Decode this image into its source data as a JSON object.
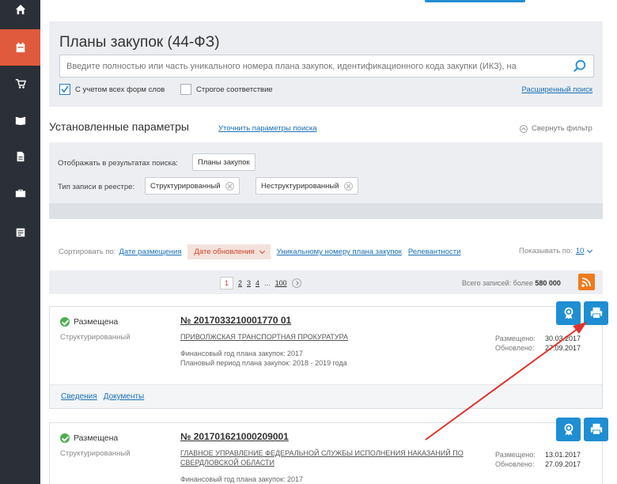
{
  "search": {
    "title": "Планы закупок (44-ФЗ)",
    "placeholder": "Введите полностью или часть уникального номера плана закупок, идентификационного кода закупки (ИКЗ), на",
    "all_forms_label": "С учетом всех форм слов",
    "all_forms_checked": true,
    "strict_label": "Строгое соответствие",
    "strict_checked": false,
    "advanced_link": "Расширенный поиск"
  },
  "params": {
    "heading": "Установленные параметры",
    "refine_link": "Уточнить параметры поиска",
    "collapse_label": "Свернуть фильтр"
  },
  "filters": {
    "show_label": "Отображать в результатах поиска:",
    "show_chip": "Планы закупок",
    "record_type_label": "Тип записи в реестре:",
    "record_chips": [
      "Структурированный",
      "Неструктурированный"
    ]
  },
  "sort": {
    "label": "Сортировать по:",
    "options": [
      "Дате размещения",
      "Дате обновления",
      "Уникальному номеру плана закупок",
      "Релевантности"
    ],
    "active": "Дате обновления",
    "per_page_label": "Показывать по:",
    "per_page_value": "10"
  },
  "pager": {
    "current": "1",
    "pages": [
      "2",
      "3",
      "4"
    ],
    "ellipsis": "...",
    "last": "100",
    "total_label": "Всего записей: более",
    "total_value": "580 000"
  },
  "cards": [
    {
      "status": "Размещена",
      "type": "Структурированный",
      "number": "№ 2017033210001770 01",
      "org": "ПРИВОЛЖСКАЯ ТРАНСПОРТНАЯ ПРОКУРАТУРА",
      "fin_year": "Финансовый год плана закупок: 2017",
      "plan_period": "Плановый период плана закупок: 2018 - 2019 года",
      "placed_label": "Размещено:",
      "placed_value": "30.03.2017",
      "updated_label": "Обновлено:",
      "updated_value": "27.09.2017",
      "links": [
        "Сведения",
        "Документы"
      ]
    },
    {
      "status": "Размещена",
      "type": "Структурированный",
      "number": "№ 201701621000209001",
      "org": "ГЛАВНОЕ УПРАВЛЕНИЕ ФЕДЕРАЛЬНОЙ СЛУЖБЫ ИСПОЛНЕНИЯ НАКАЗАНИЙ ПО СВЕРДЛОВСКОЙ ОБЛАСТИ",
      "fin_year": "Финансовый год плана закупок: 2017",
      "placed_label": "Размещено:",
      "placed_value": "13.01.2017",
      "updated_label": "Обновлено:",
      "updated_value": "27.09.2017"
    }
  ],
  "colors": {
    "sidebar": "#2b3038",
    "accent": "#e05a3d",
    "primary": "#1f8ed2",
    "link": "#1a6fb5",
    "annotation_arrow": "#e0322b"
  }
}
